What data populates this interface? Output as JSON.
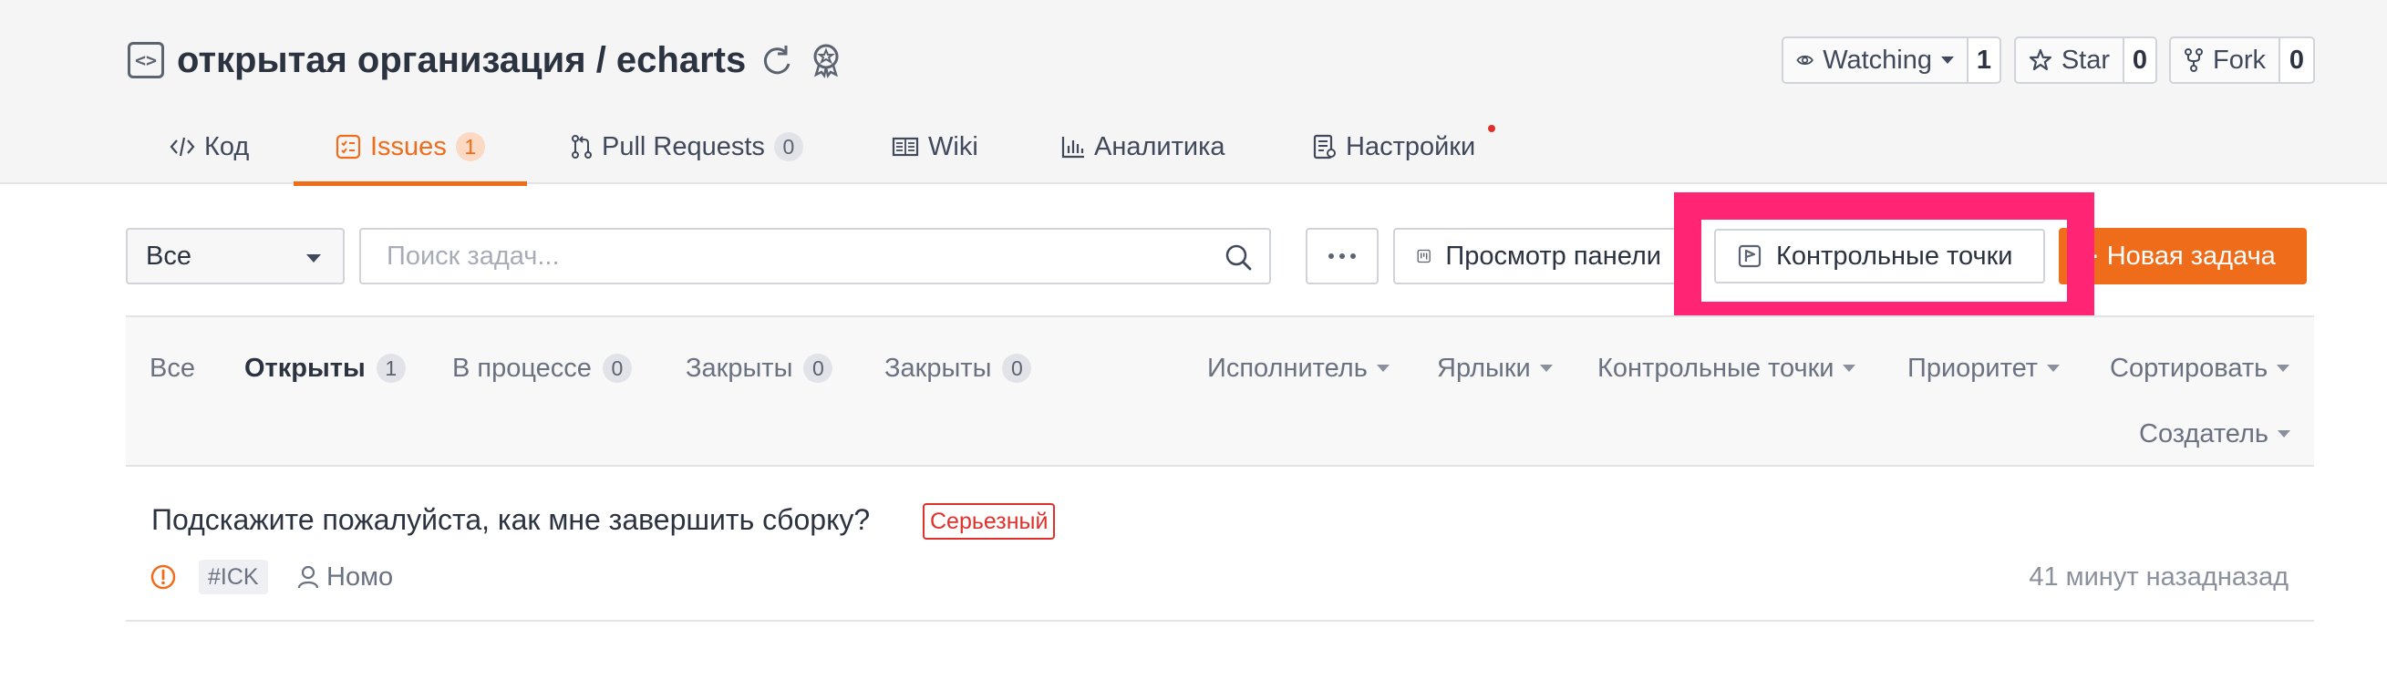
{
  "repo": {
    "title": "открытая организация / echarts",
    "icons": [
      "code-box-icon",
      "sync-icon",
      "award-icon"
    ]
  },
  "actions": {
    "watch": {
      "label": "Watching",
      "count": "1",
      "icon": "eye-icon"
    },
    "star": {
      "label": "Star",
      "count": "0",
      "icon": "star-icon"
    },
    "fork": {
      "label": "Fork",
      "count": "0",
      "icon": "fork-icon"
    }
  },
  "tabs": [
    {
      "label": "Код",
      "icon": "code-icon"
    },
    {
      "label": "Issues",
      "badge": "1",
      "icon": "issues-icon",
      "active": true
    },
    {
      "label": "Pull Requests",
      "badge": "0",
      "icon": "pull-request-icon"
    },
    {
      "label": "Wiki",
      "icon": "book-icon"
    },
    {
      "label": "Аналитика",
      "icon": "bar-chart-icon"
    },
    {
      "label": "Настройки",
      "icon": "settings-doc-icon",
      "notification": true
    }
  ],
  "toolbar": {
    "filter_select": "Все",
    "search_placeholder": "Поиск задач...",
    "board_view": "Просмотр панели",
    "milestones": "Контрольные точки",
    "new_issue": "Новая задача"
  },
  "states": [
    {
      "label": "Все"
    },
    {
      "label": "Открыты",
      "count": "1",
      "active": true
    },
    {
      "label": "В процессе",
      "count": "0"
    },
    {
      "label": "Закрыты",
      "count": "0"
    },
    {
      "label": "Закрыты",
      "count": "0"
    }
  ],
  "filters": [
    "Исполнитель",
    "Ярлыки",
    "Контрольные точки",
    "Приоритет",
    "Сортировать",
    "Создатель"
  ],
  "issues": [
    {
      "title": "Подскажите пожалуйста, как мне завершить сборку?",
      "label": "Серьезный",
      "id": "#ICK",
      "author": "Номо",
      "time": "41 минут назадназад"
    }
  ],
  "colors": {
    "accent": "#ef6c1a",
    "highlight": "#ff2574",
    "danger": "#e0302b"
  }
}
